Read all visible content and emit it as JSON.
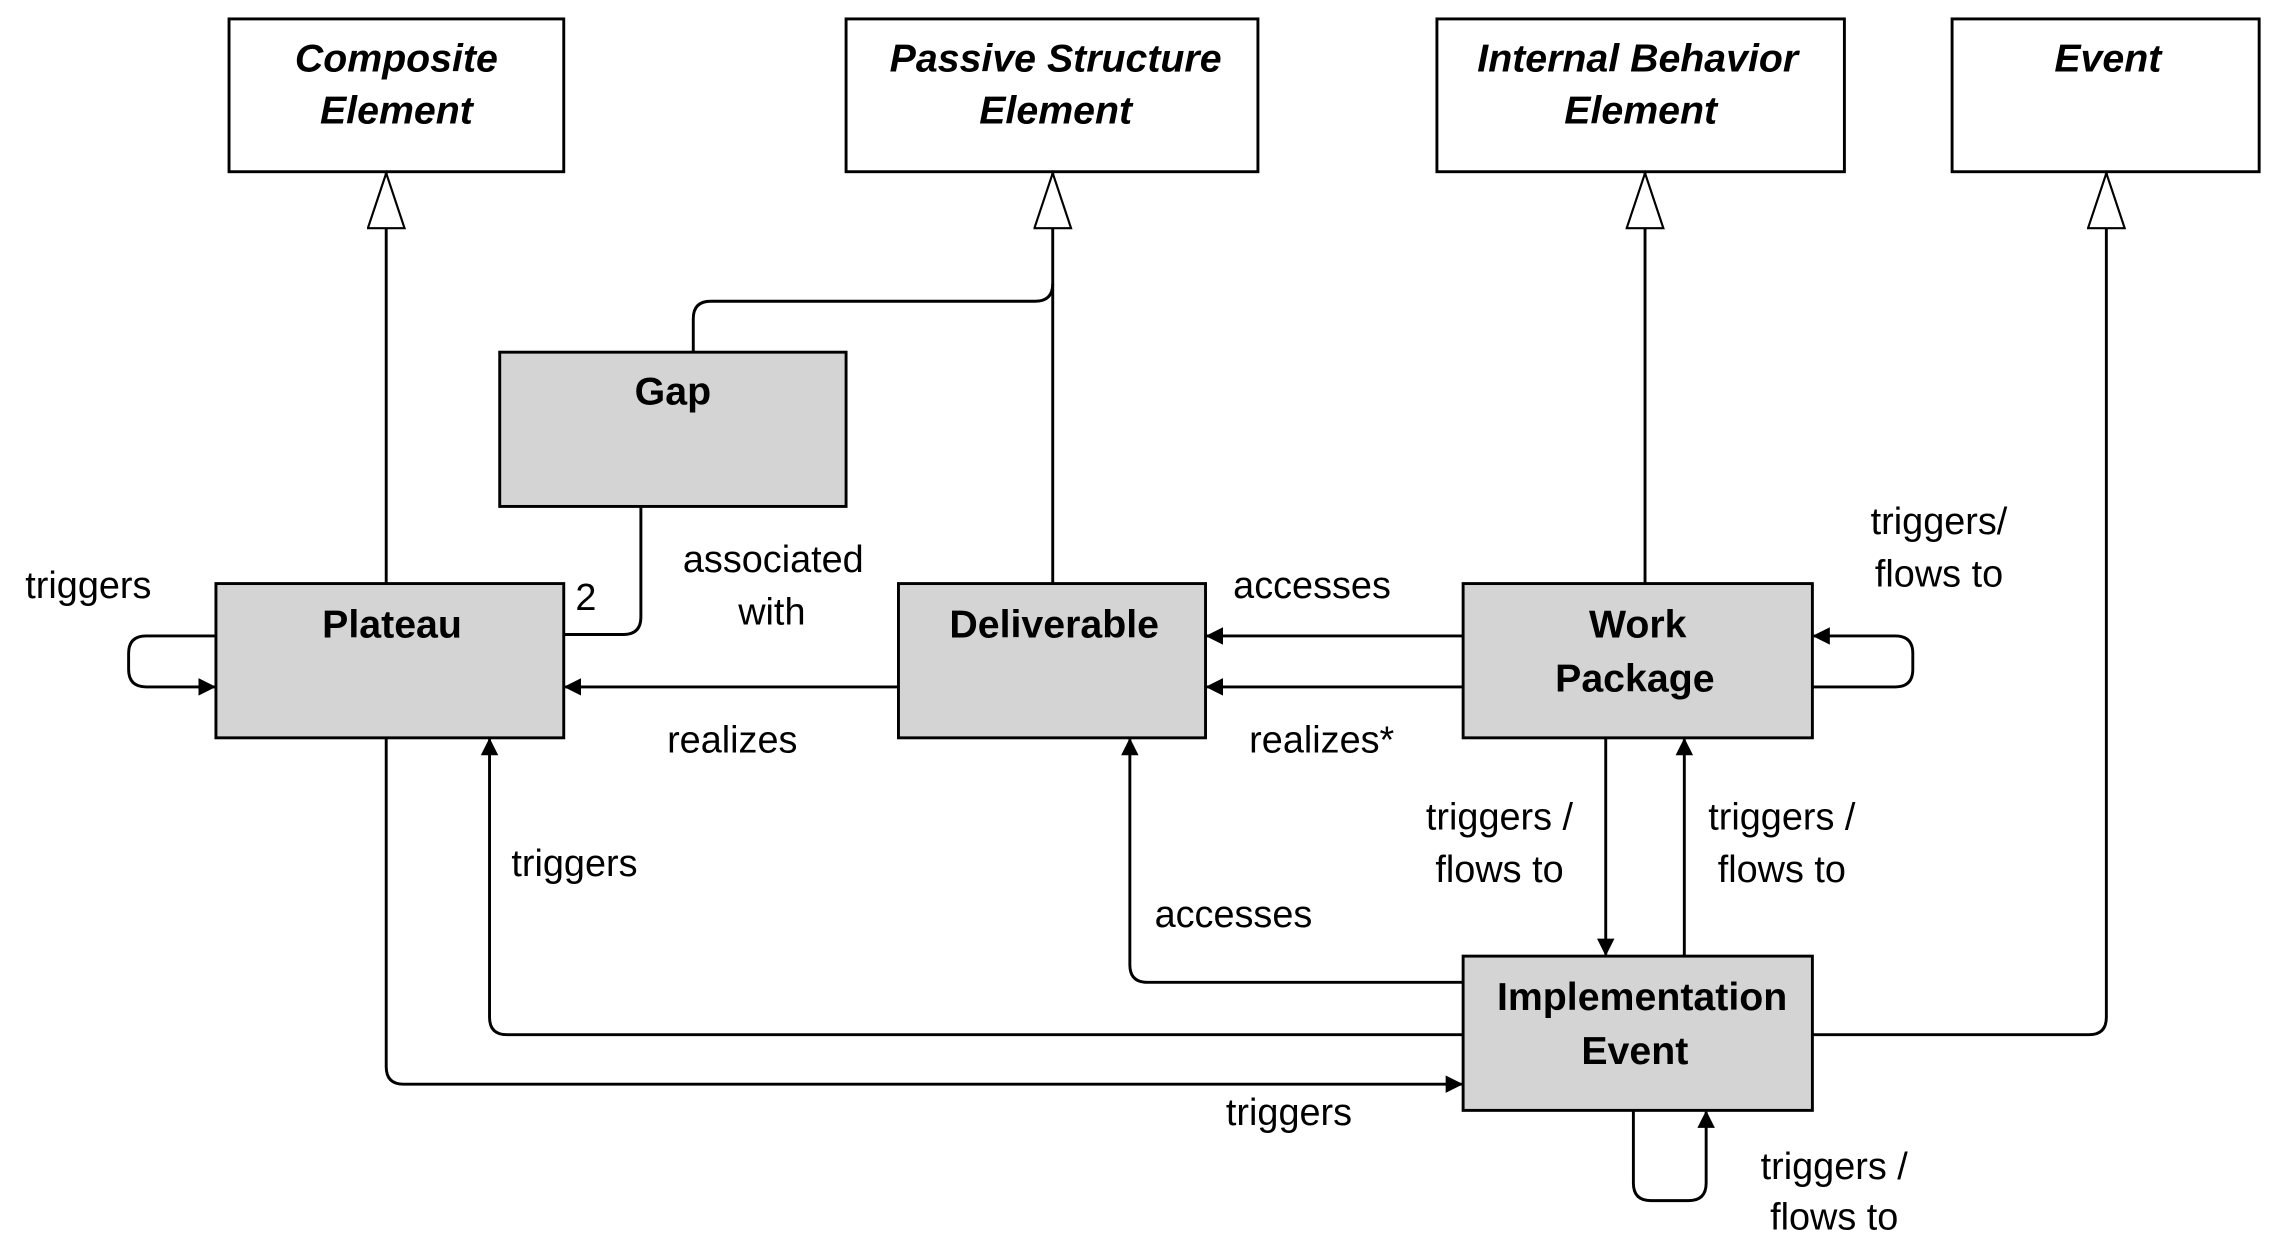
{
  "colors": {
    "concrete_fill": "#d4d4d4",
    "abstract_fill": "#ffffff",
    "line": "#000000"
  },
  "abstract_elements": [
    {
      "id": "composite",
      "lines": [
        "Composite",
        "Element"
      ]
    },
    {
      "id": "passive",
      "lines": [
        "Passive Structure",
        "Element"
      ]
    },
    {
      "id": "internal",
      "lines": [
        "Internal Behavior",
        "Element"
      ]
    },
    {
      "id": "event",
      "lines": [
        "Event"
      ]
    }
  ],
  "elements": [
    {
      "id": "gap",
      "lines": [
        "Gap"
      ]
    },
    {
      "id": "plateau",
      "lines": [
        "Plateau"
      ]
    },
    {
      "id": "deliverable",
      "lines": [
        "Deliverable"
      ]
    },
    {
      "id": "work_package",
      "lines": [
        "Work",
        "Package"
      ]
    },
    {
      "id": "implementation_event",
      "lines": [
        "Implementation",
        "Event"
      ]
    }
  ],
  "labels": {
    "plateau_self": "triggers",
    "gap_multiplicity": "2",
    "gap_assoc": [
      "associated",
      "with"
    ],
    "deliv_realizes_plateau": "realizes",
    "wp_accesses_deliv": "accesses",
    "wp_realizes_deliv": "realizes*",
    "wp_self": [
      "triggers/",
      "flows to"
    ],
    "wp_to_ie": [
      "triggers /",
      "flows to"
    ],
    "ie_to_wp": [
      "triggers /",
      "flows to"
    ],
    "ie_accesses_deliv": "accesses",
    "ie_triggers_plateau": "triggers",
    "plateau_triggers_ie": "triggers",
    "ie_self": [
      "triggers /",
      "flows to"
    ]
  }
}
